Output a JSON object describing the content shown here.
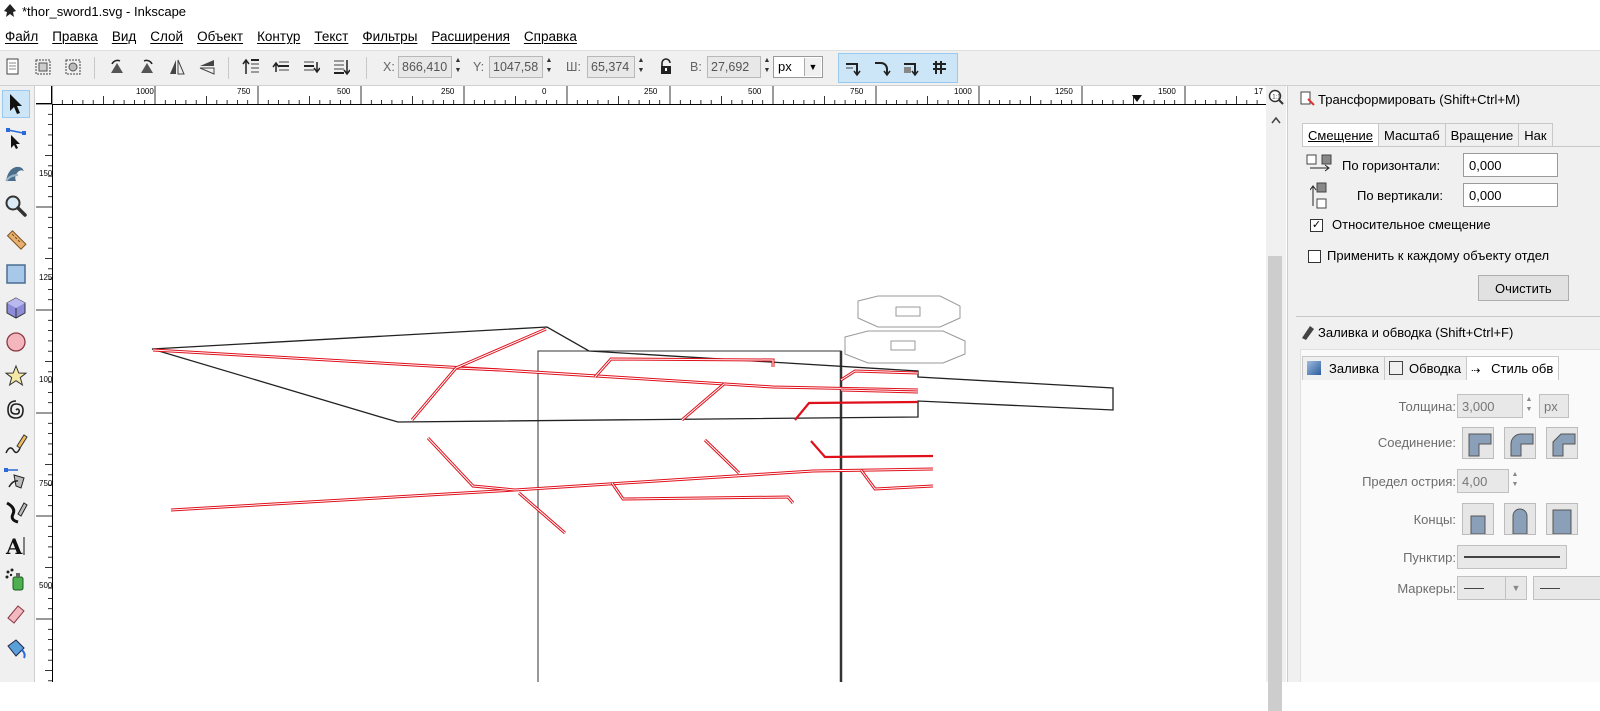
{
  "window": {
    "title": "*thor_sword1.svg - Inkscape"
  },
  "menu": [
    "Файл",
    "Правка",
    "Вид",
    "Слой",
    "Объект",
    "Контур",
    "Текст",
    "Фильтры",
    "Расширения",
    "Справка"
  ],
  "toolbar": {
    "x_label": "X:",
    "x_value": "866,410",
    "y_label": "Y:",
    "y_value": "1047,58",
    "w_label": "Ш:",
    "w_value": "65,374",
    "h_label": "В:",
    "h_value": "27,692",
    "unit": "px"
  },
  "ruler": {
    "horizontal": [
      "1000",
      "750",
      "500",
      "250",
      "0",
      "250",
      "500",
      "750",
      "1000",
      "1250",
      "1500",
      "17"
    ],
    "vertical": [
      "1500",
      "1250",
      "1000",
      "750",
      "500"
    ]
  },
  "transform_panel": {
    "title": "Трансформировать (Shift+Ctrl+M)",
    "tabs": [
      "Смещение",
      "Масштаб",
      "Вращение",
      "Нак"
    ],
    "horizontal_label": "По горизонтали:",
    "horizontal_value": "0,000",
    "vertical_label": "По вертикали:",
    "vertical_value": "0,000",
    "relative_label": "Относительное смещение",
    "relative_checked": true,
    "each_label": "Применить к каждому объекту отдел",
    "each_checked": false,
    "clear_button": "Очистить"
  },
  "fill_panel": {
    "title": "Заливка и обводка (Shift+Ctrl+F)",
    "tabs": [
      "Заливка",
      "Обводка",
      "Стиль обв"
    ],
    "width_label": "Толщина:",
    "width_value": "3,000",
    "width_unit": "px",
    "join_label": "Соединение:",
    "miter_label": "Предел острия:",
    "miter_value": "4,00",
    "caps_label": "Концы:",
    "dash_label": "Пунктир:",
    "markers_label": "Маркеры:"
  },
  "icons": {
    "tools": [
      "selector-arrow-icon",
      "node-editor-icon",
      "tweak-icon",
      "zoom-icon",
      "measure-icon",
      "rectangle-icon",
      "3d-box-icon",
      "ellipse-icon",
      "star-icon",
      "spiral-icon",
      "pencil-icon",
      "pen-icon",
      "calligraphy-icon",
      "text-icon",
      "spray-icon",
      "eraser-icon",
      "paint-bucket-icon"
    ]
  },
  "colors": {
    "accent": "#cde6f7",
    "red_path": "#e0101b",
    "panel_bg": "#f0f0f0"
  }
}
